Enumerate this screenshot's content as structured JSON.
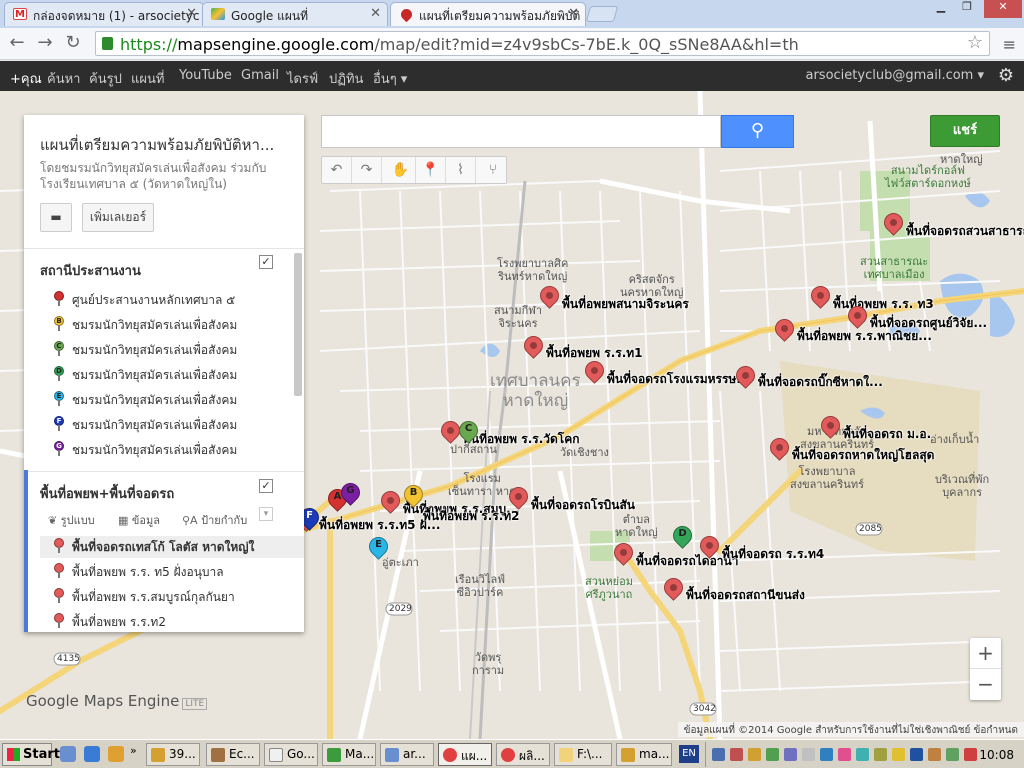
{
  "browser": {
    "tabs": [
      {
        "label": "กล่องจดหมาย (1) - arsocietyc",
        "icon": "gmail-icon"
      },
      {
        "label": "Google แผนที่",
        "icon": "maps-icon"
      },
      {
        "label": "แผนที่เตรียมความพร้อมภัยพิบัติ",
        "icon": "mapsengine-icon"
      }
    ],
    "url_scheme": "https://",
    "url_host": "mapsengine.google.com",
    "url_path": "/map/edit?mid=z4v9sbCs-7bE.k_0Q_sSNe8AA&hl=th"
  },
  "google_bar": {
    "items": [
      "+คุณ",
      "ค้นหา",
      "ค้นรูป",
      "แผนที่",
      "YouTube",
      "Gmail",
      "ไดรฟ์",
      "ปฏิทิน",
      "อื่นๆ ▾"
    ],
    "account": "arsocietyclub@gmail.com ▾"
  },
  "panel": {
    "title": "แผนที่เตรียมความพร้อมภัยพิบัติหา...",
    "description": "โดยชมรมนักวิทยุสมัครเล่นเพื่อสังคม ร่วมกับโรงเรียนเทศบาล ๕ (วัดหาดใหญ่ใน)",
    "add_layer": "เพิ่มเลเยอร์",
    "layer1": {
      "title": "สถานีประสานงาน",
      "items": [
        {
          "label": "ศูนย์ประสานงานหลักเทศบาล ๕",
          "color": "#d43131",
          "letter": ""
        },
        {
          "label": "ชมรมนักวิทยุสมัครเล่นเพื่อสังคม",
          "color": "#f1c232",
          "letter": "B"
        },
        {
          "label": "ชมรมนักวิทยุสมัครเล่นเพื่อสังคม",
          "color": "#6aa84f",
          "letter": "C"
        },
        {
          "label": "ชมรมนักวิทยุสมัครเล่นเพื่อสังคม",
          "color": "#33a65a",
          "letter": "D"
        },
        {
          "label": "ชมรมนักวิทยุสมัครเล่นเพื่อสังคม",
          "color": "#29b6e6",
          "letter": "E"
        },
        {
          "label": "ชมรมนักวิทยุสมัครเล่นเพื่อสังคม",
          "color": "#1d3bb8",
          "letter": "F"
        },
        {
          "label": "ชมรมนักวิทยุสมัครเล่นเพื่อสังคม",
          "color": "#7b1fa2",
          "letter": "G"
        }
      ]
    },
    "layer2": {
      "title": "พื้นที่อพยพ+พื้นที่จอดรถ",
      "tool_style": "รูปแบบ",
      "tool_data": "ข้อมูล",
      "tool_labels": "ป้ายกำกับ",
      "items": [
        "พื้นที่จอดรถเทสโก้ โลตัส หาดใหญ่ใ",
        "พื้นที่อพยพ ร.ร. ท5 ฝั่งอนุบาล",
        "พื้นที่อพยพ ร.ร.สมบูรณ์กุลกันยา",
        "พื้นที่อพยพ ร.ร.ท2"
      ]
    }
  },
  "map": {
    "share_label": "แชร์",
    "logo": "Google",
    "product": "Maps Engine",
    "lite": "LITE",
    "attribution": "ข้อมูลแผนที่ ©2014 Google   สำหรับการใช้งานที่ไม่ใช่เชิงพาณิชย์   ข้อกำหนด",
    "zoom_in": "+",
    "zoom_out": "−",
    "area_labels": [
      {
        "text": "เทศบาลนคร\nหาดใหญ่",
        "cls": "big"
      },
      {
        "text": "โรงพยาบาลศิค\nรินทร์หาดใหญ่",
        "cls": ""
      },
      {
        "text": "คริสตจักร\nนครหาดใหญ่",
        "cls": ""
      },
      {
        "text": "สนามกีฬา\nจิระนคร",
        "cls": ""
      },
      {
        "text": "สนามไดร์กอล์ฟ\nไฟว์สตาร์ดอกหงษ์",
        "cls": "green"
      },
      {
        "text": "สวนสาธารณะ\nเทศบาลเมือง",
        "cls": "green"
      },
      {
        "text": "โรงพยาบาล\nสงขลานครินทร์",
        "cls": ""
      },
      {
        "text": "มหาวิทยาลัย\nสงขลานครินทร์",
        "cls": ""
      },
      {
        "text": "ตำบล\nหาดใหญ่",
        "cls": ""
      },
      {
        "text": "สวนหย่อม\nศรีภูวนาถ",
        "cls": "green"
      },
      {
        "text": "เรือนวิไลฟ์\nซีอิวปาร์ค",
        "cls": ""
      },
      {
        "text": "โรงแรม\nเซ็นทารา หาด",
        "cls": ""
      },
      {
        "text": "วัดเชิงชาง",
        "cls": ""
      },
      {
        "text": "ปากีสถาน",
        "cls": ""
      },
      {
        "text": "อู่ตะเภา",
        "cls": ""
      },
      {
        "text": "บริเวณที่พัก\nบุคลากร",
        "cls": ""
      },
      {
        "text": "วัดพรุ\nการาม",
        "cls": ""
      },
      {
        "text": "อ่างเก็บน้ำ",
        "cls": ""
      },
      {
        "text": "หาดใหญ่",
        "cls": ""
      }
    ],
    "markers": [
      {
        "label": "พื้นที่จอดรถสวนสาธารณ",
        "color": "#e35a5a"
      },
      {
        "label": "พื้นที่อพยพสนามจิระนคร",
        "color": "#e35a5a"
      },
      {
        "label": "พื้นที่อพยพ ร.ร. ท3",
        "color": "#e35a5a"
      },
      {
        "label": "พื้นที่จอดรถศูนย์วิจัย...",
        "color": "#e35a5a"
      },
      {
        "label": "พื้นที่อพยพ ร.ร.พาณิชย...",
        "color": "#e35a5a"
      },
      {
        "label": "พื้นที่อพยพ ร.ร.ท1",
        "color": "#e35a5a"
      },
      {
        "label": "พื้นที่จอดรถโรงแรมหรรษ...",
        "color": "#e35a5a"
      },
      {
        "label": "พื้นที่จอดรถบิ๊กซีหาดใ...",
        "color": "#e35a5a"
      },
      {
        "label": "พื้นที่จอดรถ ม.อ.",
        "color": "#e35a5a"
      },
      {
        "label": "พื้นที่จอดรถหาดใหญ่โฮลสุด",
        "color": "#e35a5a"
      },
      {
        "label": "พื้นที่อพยพ ร.ร.วัดโคก",
        "color": "#e35a5a"
      },
      {
        "label": "พื้นที่จอดรถโรบินสัน",
        "color": "#e35a5a"
      },
      {
        "label": "พื้นที่อพยพ ร.ร.ท5 ฝั...",
        "color": "#e35a5a"
      },
      {
        "label": "พื้นที่อพยพ ร.ร.สมบู...",
        "color": "#e35a5a"
      },
      {
        "label": "พื้นที่อพยพ ร.ร.ท2",
        "color": "#e35a5a"
      },
      {
        "label": "พื้นที่จอดรถไดอาน่า",
        "color": "#e35a5a"
      },
      {
        "label": "พื้นที่จอดรถ ร.ร.ท4",
        "color": "#e35a5a"
      },
      {
        "label": "พื้นที่จอดรถสถานีขนส่ง",
        "color": "#e35a5a"
      },
      {
        "label": "",
        "color": "#6aa84f",
        "letter": "C"
      },
      {
        "label": "",
        "color": "#d43131",
        "letter": "A"
      },
      {
        "label": "",
        "color": "#7b1fa2",
        "letter": "G"
      },
      {
        "label": "",
        "color": "#f1c232",
        "letter": "B"
      },
      {
        "label": "",
        "color": "#33a65a",
        "letter": "D"
      },
      {
        "label": "",
        "color": "#29b6e6",
        "letter": "E"
      },
      {
        "label": "",
        "color": "#1d3bb8",
        "letter": "F"
      }
    ],
    "road_numbers": [
      "2085",
      "4135",
      "2029",
      "3042"
    ]
  },
  "taskbar": {
    "start": "Start",
    "buttons": [
      "39...",
      "Ec...",
      "Go...",
      "Ma...",
      "ar...",
      "แผ...",
      "ผลิ...",
      "F:\\...",
      "ma..."
    ],
    "lang": "EN",
    "clock": "10:08"
  }
}
